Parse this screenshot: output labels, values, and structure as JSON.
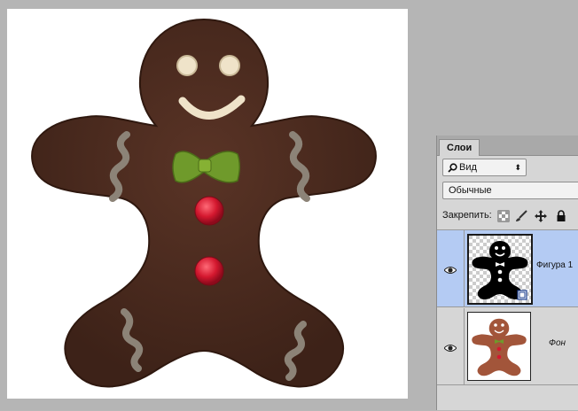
{
  "panel": {
    "tab_label": "Слои",
    "filter_label": "Вид",
    "blend_mode": "Обычные",
    "lock_label": "Закрепить:"
  },
  "layers": [
    {
      "name": "Фигура 1",
      "selected": true
    },
    {
      "name": "Фон",
      "selected": false
    }
  ],
  "colors": {
    "cookie_brown": "#4a2a1e",
    "icing": "#efe3c9",
    "bowtie_green": "#6f9a2b",
    "button_red": "#d4182f",
    "selected_layer": "#b4cbf3"
  }
}
